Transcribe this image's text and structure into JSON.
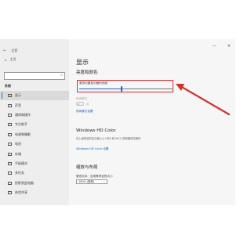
{
  "window": {
    "title": "设置",
    "minimize_icon": "minimize-icon",
    "close_icon": "close-icon"
  },
  "sidebar": {
    "home_label": "主页",
    "search_placeholder": "",
    "section_label": "系统",
    "items": [
      {
        "label": "显示",
        "icon": "monitor-icon",
        "active": true
      },
      {
        "label": "声音",
        "icon": "speaker-icon",
        "active": false
      },
      {
        "label": "通知和操作",
        "icon": "notification-icon",
        "active": false
      },
      {
        "label": "专注助手",
        "icon": "moon-icon",
        "active": false
      },
      {
        "label": "电源和睡眠",
        "icon": "power-icon",
        "active": false
      },
      {
        "label": "电池",
        "icon": "battery-icon",
        "active": false
      },
      {
        "label": "存储",
        "icon": "storage-icon",
        "active": false
      },
      {
        "label": "平板模式",
        "icon": "tablet-icon",
        "active": false
      },
      {
        "label": "多任务",
        "icon": "multitask-icon",
        "active": false
      },
      {
        "label": "投影到此电脑",
        "icon": "project-icon",
        "active": false
      },
      {
        "label": "体验共享",
        "icon": "share-icon",
        "active": false
      }
    ]
  },
  "main": {
    "page_title": "显示",
    "brightness_section": "亮度和颜色",
    "brightness_label": "更改内置显示器的亮度",
    "brightness_value": 0.45,
    "night_light_label": "夜间模式",
    "night_light_state": "关",
    "night_light_link": "夜间模式设置",
    "hd_title": "Windows HD Color",
    "hd_desc": "在上面所选的显示器上以 HDR 和 WCG 视频播放流媒体",
    "hd_link": "Windows HD Color 设置",
    "scale_title": "缩放与布局",
    "scale_label": "更改文本、应用等项目的大小",
    "scale_value": "100% (推荐)"
  },
  "colors": {
    "accent": "#1e64c8",
    "highlight": "#d4302e"
  }
}
